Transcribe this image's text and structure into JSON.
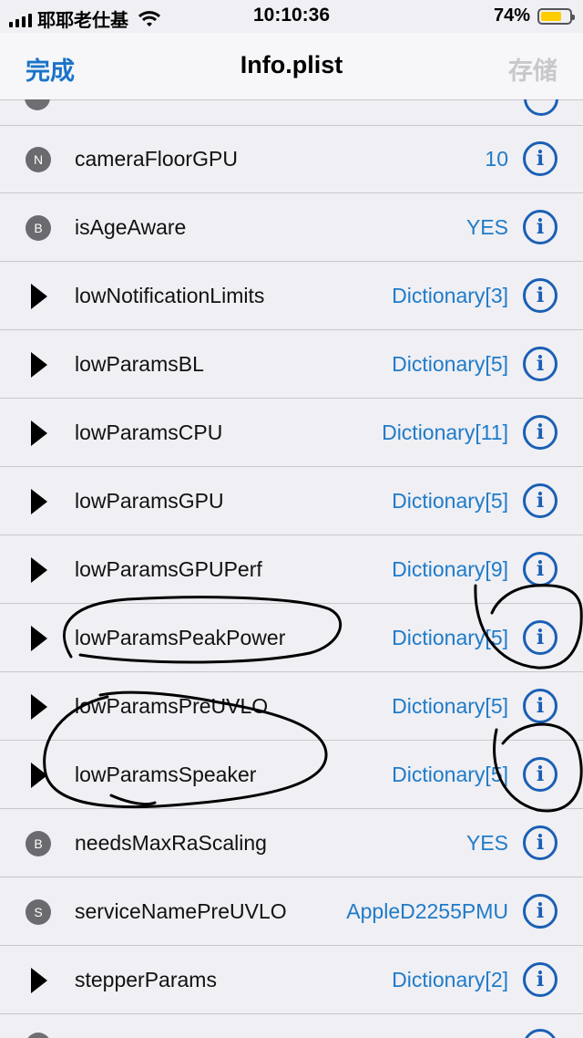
{
  "status": {
    "carrier": "耶耶老仕基",
    "time": "10:10:36",
    "battery_pct": "74%",
    "battery_level": 0.74
  },
  "nav": {
    "done": "完成",
    "title": "Info.plist",
    "save": "存储"
  },
  "rows": [
    {
      "type": "N",
      "icon": "number-badge-icon",
      "key": "cameraFloorGPU",
      "value": "10"
    },
    {
      "type": "B",
      "icon": "boolean-badge-icon",
      "key": "isAgeAware",
      "value": "YES"
    },
    {
      "type": "dict",
      "icon": "disclosure-triangle-icon",
      "key": "lowNotificationLimits",
      "value": "Dictionary[3]"
    },
    {
      "type": "dict",
      "icon": "disclosure-triangle-icon",
      "key": "lowParamsBL",
      "value": "Dictionary[5]"
    },
    {
      "type": "dict",
      "icon": "disclosure-triangle-icon",
      "key": "lowParamsCPU",
      "value": "Dictionary[11]"
    },
    {
      "type": "dict",
      "icon": "disclosure-triangle-icon",
      "key": "lowParamsGPU",
      "value": "Dictionary[5]"
    },
    {
      "type": "dict",
      "icon": "disclosure-triangle-icon",
      "key": "lowParamsGPUPerf",
      "value": "Dictionary[9]"
    },
    {
      "type": "dict",
      "icon": "disclosure-triangle-icon",
      "key": "lowParamsPeakPower",
      "value": "Dictionary[5]"
    },
    {
      "type": "dict",
      "icon": "disclosure-triangle-icon",
      "key": "lowParamsPreUVLO",
      "value": "Dictionary[5]"
    },
    {
      "type": "dict",
      "icon": "disclosure-triangle-icon",
      "key": "lowParamsSpeaker",
      "value": "Dictionary[5]"
    },
    {
      "type": "B",
      "icon": "boolean-badge-icon",
      "key": "needsMaxRaScaling",
      "value": "YES"
    },
    {
      "type": "S",
      "icon": "string-badge-icon",
      "key": "serviceNamePreUVLO",
      "value": "AppleD2255PMU"
    },
    {
      "type": "dict",
      "icon": "disclosure-triangle-icon",
      "key": "stepperParams",
      "value": "Dictionary[2]"
    }
  ],
  "info_glyph": "i",
  "colors": {
    "accent": "#1a5fb4",
    "value_text": "#1f7bc8",
    "background": "#efeff4",
    "annotation_ink": "#000000"
  }
}
